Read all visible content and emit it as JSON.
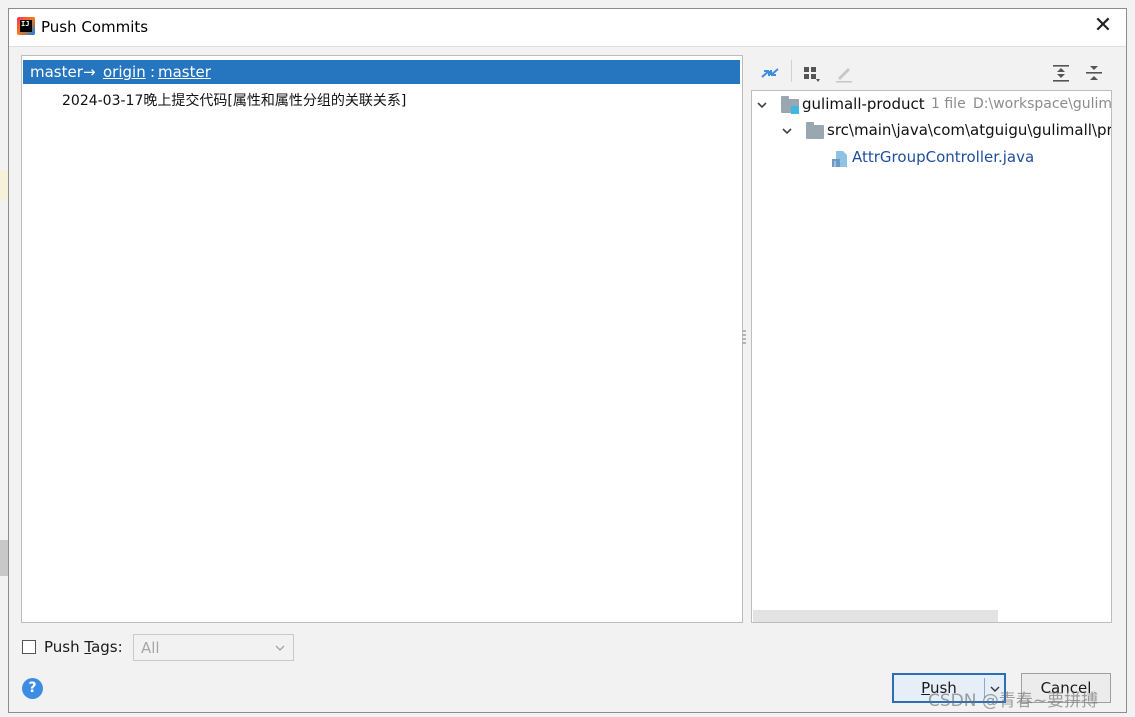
{
  "window": {
    "title": "Push Commits",
    "app_icon": "intellij-idea-icon"
  },
  "branch_row": {
    "local": "master",
    "arrow": "→",
    "remote": "origin",
    "separator": ":",
    "remote_branch": "master"
  },
  "commits": [
    {
      "message": "2024-03-17晚上提交代码[属性和属性分组的关联关系]"
    }
  ],
  "changes_toolbar": {
    "icons": [
      "show-diff-icon",
      "group-by-icon",
      "edit-source-icon",
      "expand-all-icon",
      "collapse-all-icon"
    ]
  },
  "tree": {
    "module": {
      "name": "gulimall-product",
      "count": "1 file",
      "path": "D:\\workspace\\gulimall"
    },
    "package": {
      "path": "src\\main\\java\\com\\atguigu\\gulimall\\product"
    },
    "file": {
      "name": "AttrGroupController.java"
    }
  },
  "push_tags": {
    "label_pre": "Push ",
    "label_key": "T",
    "label_post": "ags:",
    "checked": false,
    "select_value": "All"
  },
  "buttons": {
    "push_pre": "",
    "push_key": "P",
    "push_post": "ush",
    "cancel": "Cancel"
  },
  "watermark": "CSDN @青春~要拼搏",
  "colors": {
    "selection": "#2675bf",
    "link": "#1f4e9c",
    "help": "#3d8ee3"
  }
}
